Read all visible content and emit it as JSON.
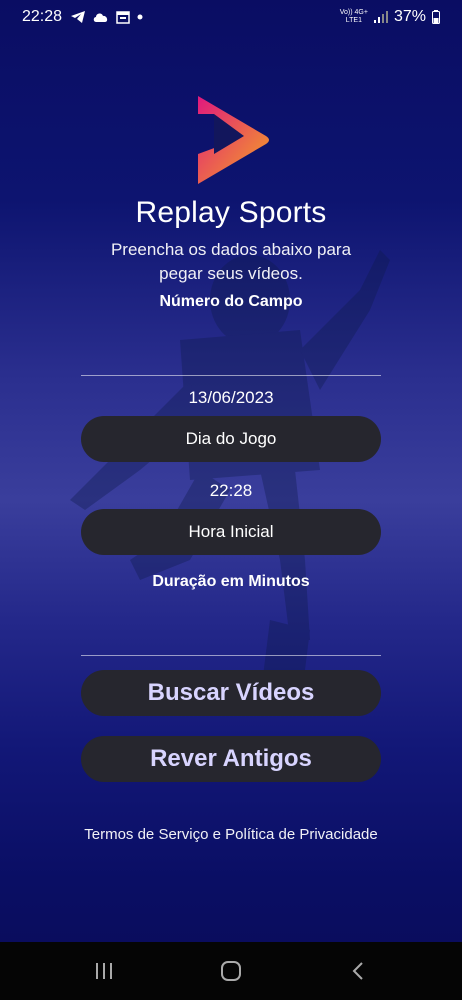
{
  "status_bar": {
    "time": "22:28",
    "network_top": "Vo)) 4G+",
    "network_bottom": "LTE1",
    "battery": "37%",
    "icons": [
      "telegram-icon",
      "cloud-icon",
      "calendar-icon",
      "dot-icon",
      "signal-icon",
      "battery-icon"
    ]
  },
  "app": {
    "title": "Replay Sports",
    "subtitle": "Preencha os dados abaixo para pegar seus vídeos.",
    "logo_colors": [
      "#e0187e",
      "#f5a623"
    ]
  },
  "form": {
    "field_label": "Número do Campo",
    "date_value": "13/06/2023",
    "date_button": "Dia do Jogo",
    "time_value": "22:28",
    "time_button": "Hora Inicial",
    "duration_label": "Duração em Minutos"
  },
  "actions": {
    "search": "Buscar Vídeos",
    "review": "Rever Antigos"
  },
  "footer": {
    "terms": "Termos de Serviço e Política de Privacidade"
  },
  "nav": {
    "icons": [
      "recent-apps-icon",
      "home-icon",
      "back-icon"
    ]
  }
}
